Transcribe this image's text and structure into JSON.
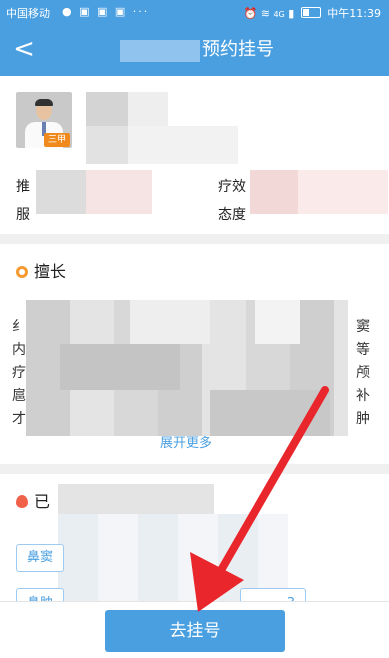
{
  "status_bar": {
    "carrier": "中国移动",
    "clock": "中午11:39",
    "signal_label": "4G"
  },
  "header": {
    "back_glyph": "<",
    "title": "预约挂号"
  },
  "doctor": {
    "badge": "三甲",
    "label_recommend": "推",
    "label_effect": "疗效",
    "label_service": "服",
    "label_attitude": "态度"
  },
  "specialty": {
    "title": "擅长",
    "fragments_left": [
      "纟",
      "内",
      "疗",
      "扈",
      "才"
    ],
    "fragments_right": [
      "窦",
      "等",
      "颅",
      "补",
      "肿"
    ],
    "more_label": "展开更多"
  },
  "registered": {
    "title": "已",
    "chip_1": "鼻窦",
    "chip_2_fragment": "鼻肿",
    "chip_3_fragment": "3"
  },
  "bottom": {
    "register_button": "去挂号"
  },
  "colors": {
    "primary": "#4a9fe0",
    "badge": "#f08a1c",
    "arrow": "#e8262b"
  }
}
